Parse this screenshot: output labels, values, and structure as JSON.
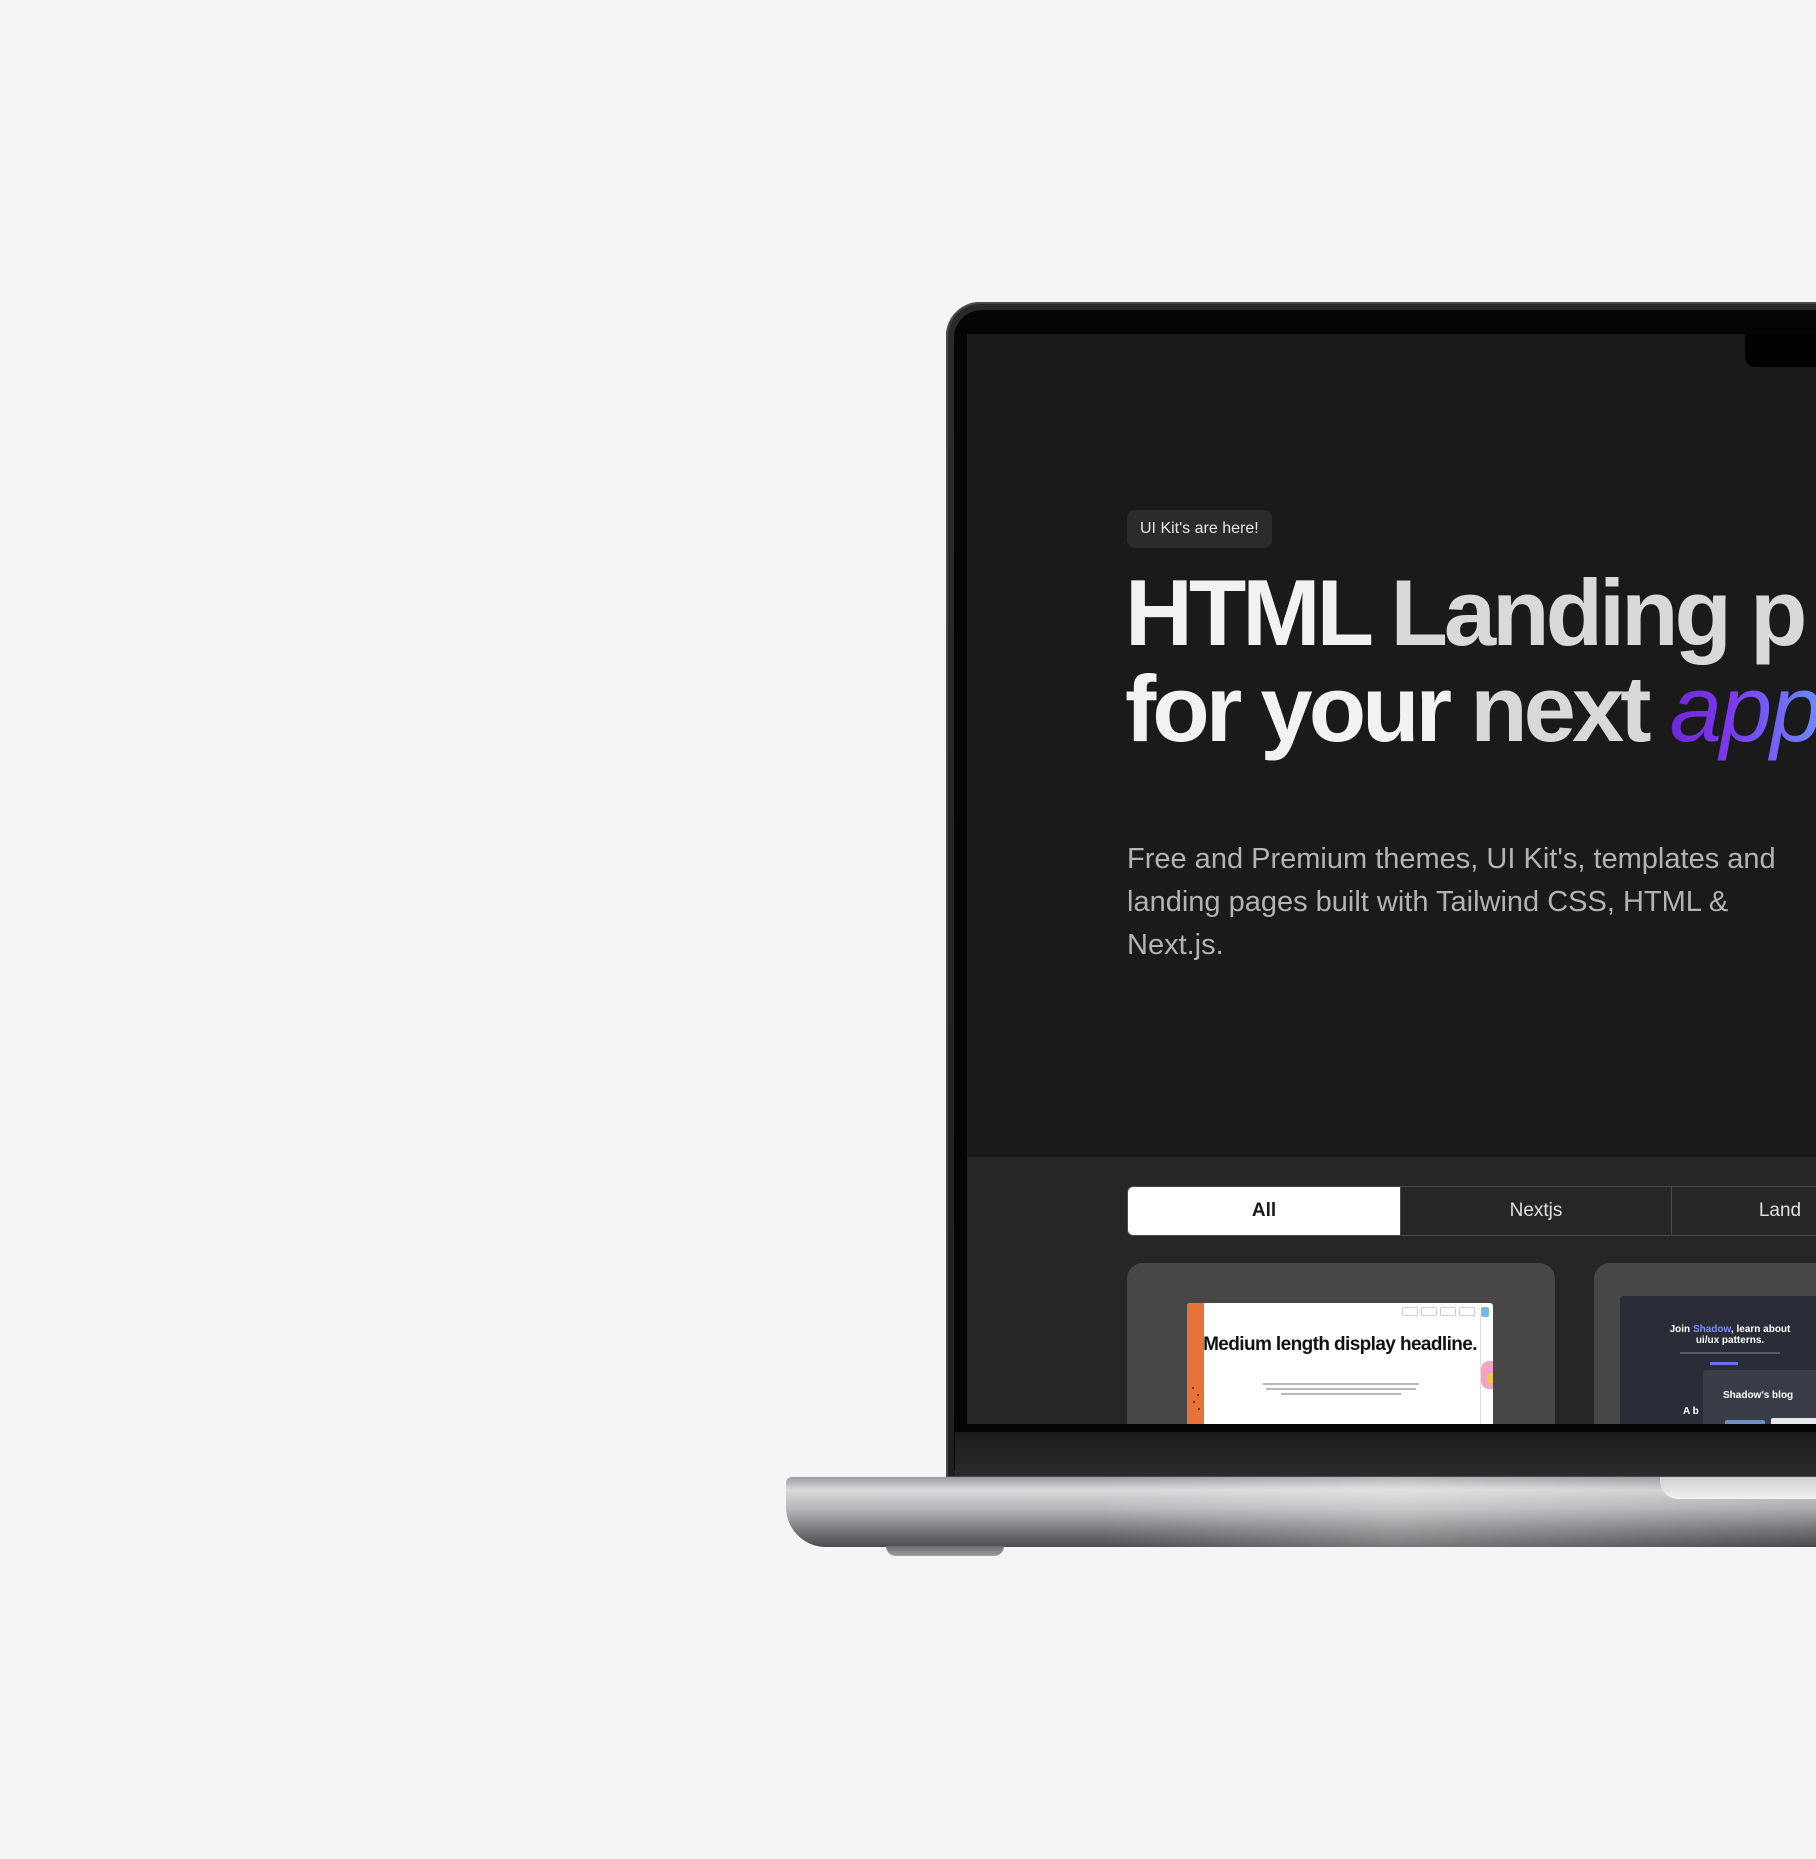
{
  "hero": {
    "badge": "UI Kit's are here!",
    "headline_line1_a": "HTML",
    "headline_line1_b": "Landing p",
    "headline_line2_a": "for your",
    "headline_line2_b": "next",
    "headline_line2_accent": "app",
    "subtitle": "Free and Premium themes, UI Kit's, templates and landing pages built with Tailwind CSS, HTML & Next.js."
  },
  "catalog": {
    "tabs": [
      {
        "label": "All",
        "active": true
      },
      {
        "label": "Nextjs",
        "active": false
      },
      {
        "label": "Land",
        "active": false
      }
    ],
    "cards": [
      {
        "thumb_title": "Medium length display headline."
      },
      {
        "thumb_title_a": "Join",
        "thumb_title_hl": "Shadow",
        "thumb_title_b": ", learn about ui/ux patterns.",
        "panel_title": "Shadow's blog",
        "sub_text": "A b"
      }
    ]
  },
  "colors": {
    "page_background": "#f5f5f5",
    "screen_background": "#1a1a1a",
    "catalog_background": "#262626",
    "accent_gradient_start": "#6d28d9",
    "accent_gradient_end": "#6b8cff"
  }
}
